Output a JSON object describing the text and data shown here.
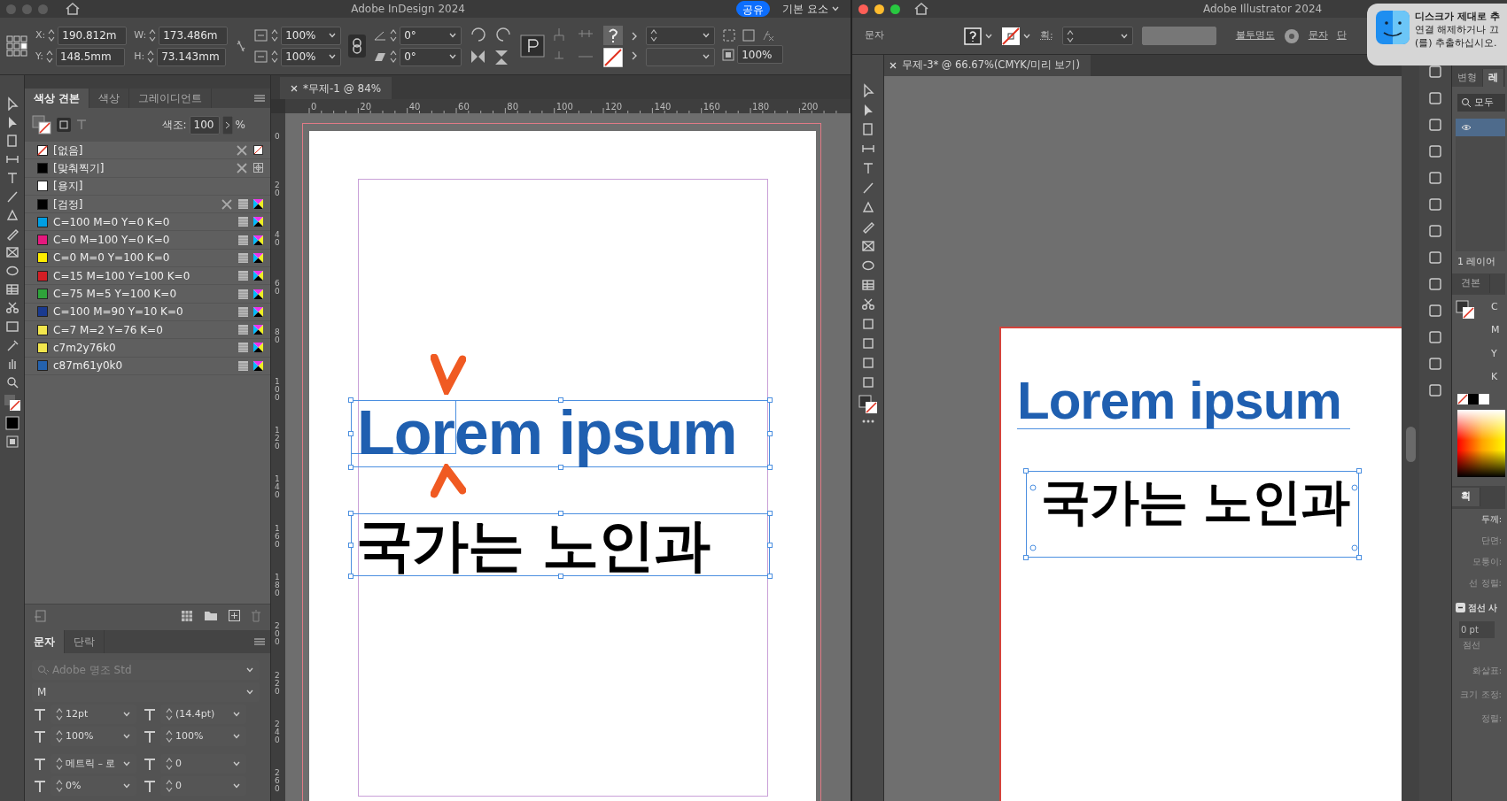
{
  "indesign": {
    "title": "Adobe InDesign 2024",
    "share_button": "공유",
    "workspace": "기본 요소",
    "transform_fields": [
      {
        "label": "X:",
        "value": "190.812m"
      },
      {
        "label": "Y:",
        "value": "148.5mm"
      },
      {
        "label": "W:",
        "value": "173.486m"
      },
      {
        "label": "H:",
        "value": "73.143mm"
      }
    ],
    "scale_fields": [
      "100%",
      "100%"
    ],
    "angle_fields": [
      "0°",
      "0°"
    ],
    "opacity": "100%",
    "panel_tabs": [
      {
        "label": "색상 견본",
        "selected": true
      },
      {
        "label": "색상",
        "selected": false
      },
      {
        "label": "그레이디언트",
        "selected": false
      }
    ],
    "tint_label": "색조:",
    "tint": "100",
    "tint_unit": "%",
    "swatches": [
      {
        "name": "[없음]",
        "kind": "none"
      },
      {
        "name": "[맞춰찍기]",
        "kind": "registration",
        "color": "#000000"
      },
      {
        "name": "[용지]",
        "kind": "paper",
        "color": "#ffffff"
      },
      {
        "name": "[검정]",
        "kind": "black",
        "color": "#000000"
      },
      {
        "name": "C=100 M=0 Y=0 K=0",
        "kind": "process",
        "color": "#009fe3"
      },
      {
        "name": "C=0 M=100 Y=0 K=0",
        "kind": "process",
        "color": "#e5197e"
      },
      {
        "name": "C=0 M=0 Y=100 K=0",
        "kind": "process",
        "color": "#ffed00"
      },
      {
        "name": "C=15 M=100 Y=100 K=0",
        "kind": "process",
        "color": "#d31e25"
      },
      {
        "name": "C=75 M=5 Y=100 K=0",
        "kind": "process",
        "color": "#2ea33a"
      },
      {
        "name": "C=100 M=90 Y=10 K=0",
        "kind": "process",
        "color": "#1a3a8f"
      },
      {
        "name": "C=7 M=2 Y=76 K=0",
        "kind": "process",
        "color": "#f2e64d"
      },
      {
        "name": "c7m2y76k0",
        "kind": "process",
        "color": "#f2e64d"
      },
      {
        "name": "c87m61y0k0",
        "kind": "process",
        "color": "#2462ae"
      }
    ],
    "character_tabs": [
      {
        "label": "문자",
        "selected": true
      },
      {
        "label": "단락",
        "selected": false
      }
    ],
    "font_family": "Adobe 명조 Std",
    "font_style": "M",
    "char_fields": [
      {
        "value": "12pt"
      },
      {
        "value": "(14.4pt)"
      },
      {
        "value": "100%"
      },
      {
        "value": "100%"
      },
      {
        "value": "메트릭 – 로"
      },
      {
        "value": "0"
      },
      {
        "value": "0%"
      },
      {
        "value": "0"
      }
    ],
    "document_tab": "*무제-1 @ 84%",
    "ruler_h": [
      "0",
      "20",
      "40",
      "60",
      "80",
      "100",
      "120",
      "140",
      "160",
      "180",
      "200"
    ],
    "ruler_v": [
      "0",
      "20",
      "40",
      "60",
      "80",
      "100",
      "120",
      "140",
      "160",
      "180",
      "200",
      "220",
      "240",
      "260"
    ],
    "heading": "Lorem ipsum",
    "body": "국가는 노인과"
  },
  "illustrator": {
    "title": "Adobe Illustrator 2024",
    "selection_label": "문자",
    "stroke_label": "획:",
    "opacity_label": "불투명도",
    "char_link": "문자",
    "para_link": "단",
    "document_tab": "무제-3* @ 66.67%(CMYK/미리 보기)",
    "panel_tabs": [
      {
        "label": "변형",
        "selected": false
      },
      {
        "label": "레",
        "selected": true
      }
    ],
    "search_text": "모두",
    "layers_count": "1 레이어",
    "swatch_tab": "견본",
    "cmyk": [
      "C",
      "M",
      "Y",
      "K"
    ],
    "stroke_tab": "획",
    "stroke_fields": [
      "두께:",
      "단면:",
      "모퉁이:",
      "선 정렬:"
    ],
    "dash_label": "점선 사",
    "dash_expanded": true,
    "dash_value": "0 pt",
    "dash_caption": "점선",
    "arrow_fields": [
      "화살표:",
      "크기 조정:",
      "정렬:"
    ],
    "heading": "Lorem ipsum",
    "body": "국가는 노인과"
  },
  "notification": {
    "title": "디스크가 제대로 추",
    "lines": [
      "연결 해제하거나 끄",
      "(를) 추출하십시오."
    ]
  }
}
